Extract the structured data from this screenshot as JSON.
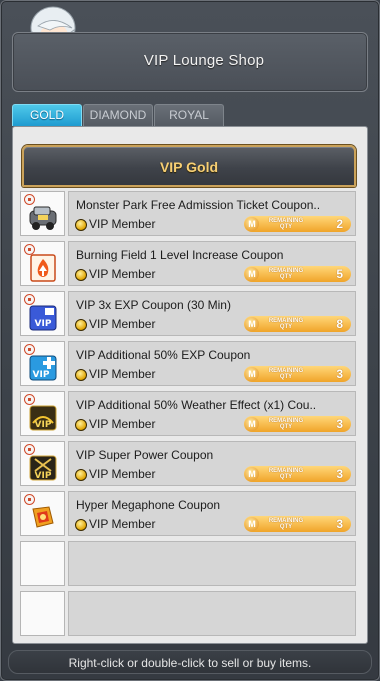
{
  "header": {
    "title": "VIP Lounge Shop"
  },
  "tabs": [
    {
      "label": "GOLD",
      "active": true
    },
    {
      "label": "DIAMOND",
      "active": false
    },
    {
      "label": "ROYAL",
      "active": false
    }
  ],
  "category": {
    "title": "VIP Gold"
  },
  "items": [
    {
      "name": "Monster Park Free Admission Ticket Coupon..",
      "tier": "VIP Member",
      "remaining_label": "REMAINING QTY",
      "remaining": "2",
      "icon": "car-coupon-icon"
    },
    {
      "name": "Burning Field 1 Level Increase Coupon",
      "tier": "VIP Member",
      "remaining_label": "REMAINING QTY",
      "remaining": "5",
      "icon": "fire-coupon-icon"
    },
    {
      "name": "VIP 3x EXP Coupon (30 Min)",
      "tier": "VIP Member",
      "remaining_label": "REMAINING QTY",
      "remaining": "8",
      "icon": "vip-exp-coupon-icon"
    },
    {
      "name": "VIP Additional 50% EXP Coupon",
      "tier": "VIP Member",
      "remaining_label": "REMAINING QTY",
      "remaining": "3",
      "icon": "vip-plus-coupon-icon"
    },
    {
      "name": "VIP Additional 50% Weather Effect (x1) Cou..",
      "tier": "VIP Member",
      "remaining_label": "REMAINING QTY",
      "remaining": "3",
      "icon": "vip-weather-coupon-icon"
    },
    {
      "name": "VIP Super Power Coupon",
      "tier": "VIP Member",
      "remaining_label": "REMAINING QTY",
      "remaining": "3",
      "icon": "vip-power-coupon-icon"
    },
    {
      "name": "Hyper Megaphone Coupon",
      "tier": "VIP Member",
      "remaining_label": "REMAINING QTY",
      "remaining": "3",
      "icon": "megaphone-coupon-icon"
    }
  ],
  "footer": {
    "hint": "Right-click or double-click to sell or buy items."
  },
  "colors": {
    "tab_active": "#2aaee0",
    "category_text": "#f7cf74",
    "qty_pill": "#f0a42a"
  }
}
